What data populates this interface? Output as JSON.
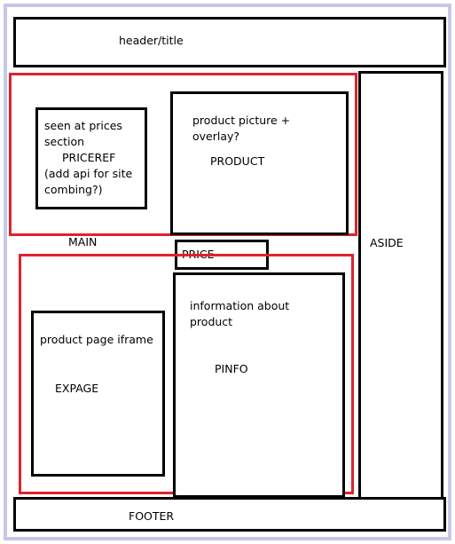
{
  "colors": {
    "frame_border": "#c8c8e6",
    "box_border": "#000000",
    "group_border": "#e0222b",
    "background": "#ffffff"
  },
  "header": {
    "label": "header/title"
  },
  "main_group": {
    "label": "MAIN",
    "priceref": {
      "note": "seen at prices\nsection",
      "name": "PRICEREF",
      "extra": "(add api for site\ncombing?)"
    },
    "product": {
      "note": "product picture +\noverlay?",
      "name": "PRODUCT"
    }
  },
  "price": {
    "label": "PRICE"
  },
  "lower_group": {
    "expage": {
      "note": "product page iframe",
      "name": "EXPAGE"
    },
    "pinfo": {
      "note": "information about\nproduct",
      "name": "PINFO"
    }
  },
  "aside": {
    "label": "ASIDE"
  },
  "footer": {
    "label": "FOOTER"
  }
}
